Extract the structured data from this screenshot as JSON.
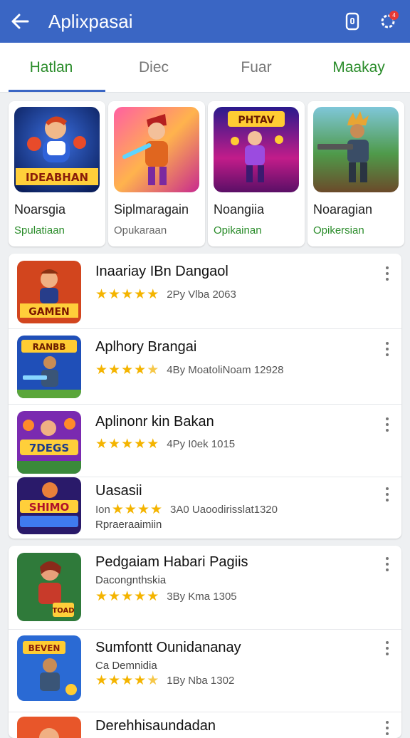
{
  "appbar": {
    "title": "Aplixpasai",
    "notification_count": "4"
  },
  "tabs": [
    {
      "label": "Hatlan",
      "state": "active"
    },
    {
      "label": "Diec",
      "state": "normal"
    },
    {
      "label": "Fuar",
      "state": "normal"
    },
    {
      "label": "Maakay",
      "state": "highlight"
    }
  ],
  "featured": [
    {
      "name": "Noarsgia",
      "sub": "Spulatiaan",
      "art_text": "IDEABHAN",
      "sub_color": "#2a8c2a"
    },
    {
      "name": "Siplmaragain",
      "sub": "Opukaraan",
      "art_text": "",
      "sub_color": "#666666"
    },
    {
      "name": "Noangiia",
      "sub": "Opikainan",
      "art_text": "PHTAV",
      "sub_color": "#2a8c2a"
    },
    {
      "name": "Noaragian",
      "sub": "Opikersian",
      "art_text": "",
      "sub_color": "#2a8c2a"
    }
  ],
  "list1": [
    {
      "title": "Inaariay IBn Dangaol",
      "meta": "2Py Vlba 2063",
      "rating": 5,
      "art_text": "GAMEN"
    },
    {
      "title": "Aplhory Brangai",
      "meta": "4By MoatoliNoam 12928",
      "rating": 4.5,
      "art_text": "RANBB"
    },
    {
      "title": "Aplinonr kin Bakan",
      "meta": "4Py I0ek 1015",
      "rating": 5,
      "art_text": "7DEGS"
    },
    {
      "title": "Uasasii",
      "prefix": "Ion",
      "meta": "3A0 Uaoodirisslat1320",
      "sub": "Rpraeraaimiin",
      "rating": 4,
      "art_text": "SHIMO"
    }
  ],
  "list2": [
    {
      "title": "Pedgaiam Habari Pagiis",
      "sub": "Dacongnthskia",
      "meta": "3By Kma 1305",
      "rating": 5,
      "art_text": "TOAD"
    },
    {
      "title": "Sumfontt Ounidananay",
      "sub": "Ca Demnidia",
      "meta": "1By Nba 1302",
      "rating": 4.5,
      "art_text": "BEVEN"
    },
    {
      "title": "Derehhisaundadan",
      "sub": "",
      "meta": "",
      "rating": 0,
      "art_text": ""
    }
  ]
}
